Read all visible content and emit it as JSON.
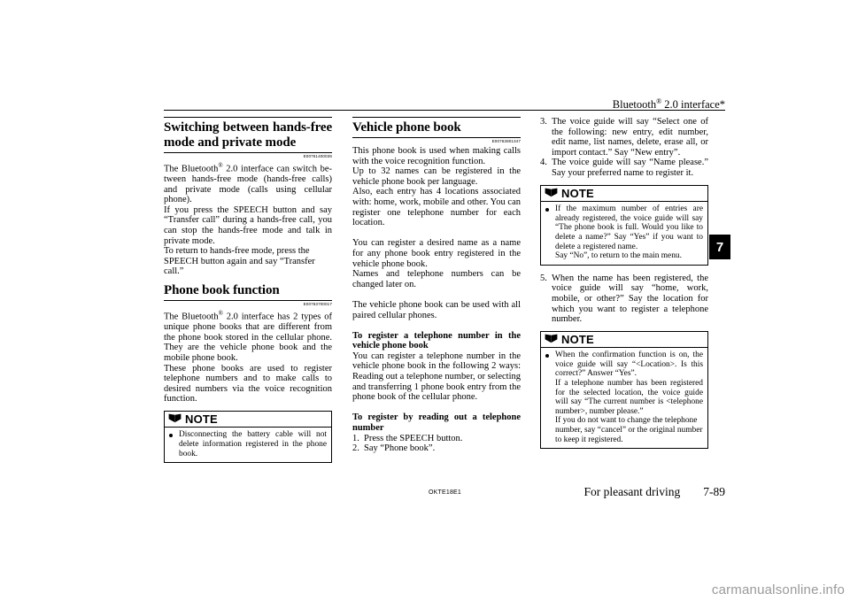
{
  "header": {
    "title_main": "Bluetooth",
    "title_sup": "®",
    "title_rest": " 2.0 interface*"
  },
  "chapter_tab": {
    "number": "7"
  },
  "footer": {
    "doc_code": "OKTE18E1",
    "section_label": "For pleasant driving",
    "page_number": "7-89"
  },
  "watermark": {
    "text": "carmanualsonline.info"
  },
  "column1": {
    "section1": {
      "heading": "Switching between hands-free mode and private mode",
      "ref_code": "E00761400036",
      "paragraphs": [
        "The Bluetooth® 2.0 interface can switch between hands-free mode (hands-free calls) and private mode (calls using cellular phone).",
        "If you press the SPEECH button and say “Transfer call” during a hands-free call, you can stop the hands-free mode and talk in private mode.",
        "To return to hands-free mode, press the SPEECH button again and say “Transfer call.”"
      ]
    },
    "section2": {
      "heading": "Phone book function",
      "ref_code": "E00763700017",
      "paragraphs": [
        "The Bluetooth® 2.0 interface has 2 types of unique phone books that are different from the phone book stored in the cellular phone. They are the vehicle phone book and the mobile phone book.",
        "These phone books are used to register telephone numbers and to make calls to desired numbers via the voice recognition function."
      ]
    },
    "note": {
      "title": "NOTE",
      "icon": "open-book-icon",
      "items": [
        "Disconnecting the battery cable will not delete information registered in the phone book."
      ]
    }
  },
  "column2": {
    "section": {
      "heading": "Vehicle phone book",
      "ref_code": "E00763801347",
      "paragraphs": [
        "This phone book is used when making calls with the voice recognition function.",
        "Up to 32 names can be registered in the vehicle phone book per language.",
        "Also, each entry has 4 locations associated with: home, work, mobile and other. You can register one telephone number for each location.",
        "You can register a desired name as a name for any phone book entry registered in the vehicle phone book.",
        "Names and telephone numbers can be changed later on.",
        "The vehicle phone book can be used with all paired cellular phones."
      ]
    },
    "sub1": {
      "heading": "To register a telephone number in the vehicle phone book",
      "paragraphs": [
        "You can register a telephone number in the vehicle phone book in the following 2 ways: Reading out a telephone number, or selecting and transferring 1 phone book entry from the phone book of the cellular phone."
      ]
    },
    "sub2": {
      "heading": "To register by reading out a telephone number",
      "steps": [
        {
          "num": "1.",
          "text": "Press the SPEECH button."
        },
        {
          "num": "2.",
          "text": "Say “Phone book”."
        }
      ]
    }
  },
  "column3": {
    "steps_top": [
      {
        "num": "3.",
        "text": "The voice guide will say “Select one of the following: new entry, edit number, edit name, list names, delete, erase all, or import contact.” Say “New entry”."
      },
      {
        "num": "4.",
        "text": "The voice guide will say “Name please.” Say your preferred name to register it."
      }
    ],
    "note1": {
      "title": "NOTE",
      "icon": "open-book-icon",
      "items": [
        "If the maximum number of entries are already registered, the voice guide will say “The phone book is full. Would you like to delete a name?” Say “Yes” if you want to delete a registered name.",
        "Say “No”, to return to the main menu."
      ]
    },
    "steps_mid": [
      {
        "num": "5.",
        "text": "When the name has been registered, the voice guide will say “home, work, mobile, or other?” Say the location for which you want to register a telephone number."
      }
    ],
    "note2": {
      "title": "NOTE",
      "icon": "open-book-icon",
      "items": [
        "When the confirmation function is on, the voice guide will say “<Location>. Is this correct?” Answer “Yes”.",
        "If a telephone number has been registered for the selected location, the voice guide will say “The current number is <telephone number>, number please.”",
        "If you do not want to change the telephone number, say “cancel” or the original number to keep it registered."
      ]
    }
  }
}
